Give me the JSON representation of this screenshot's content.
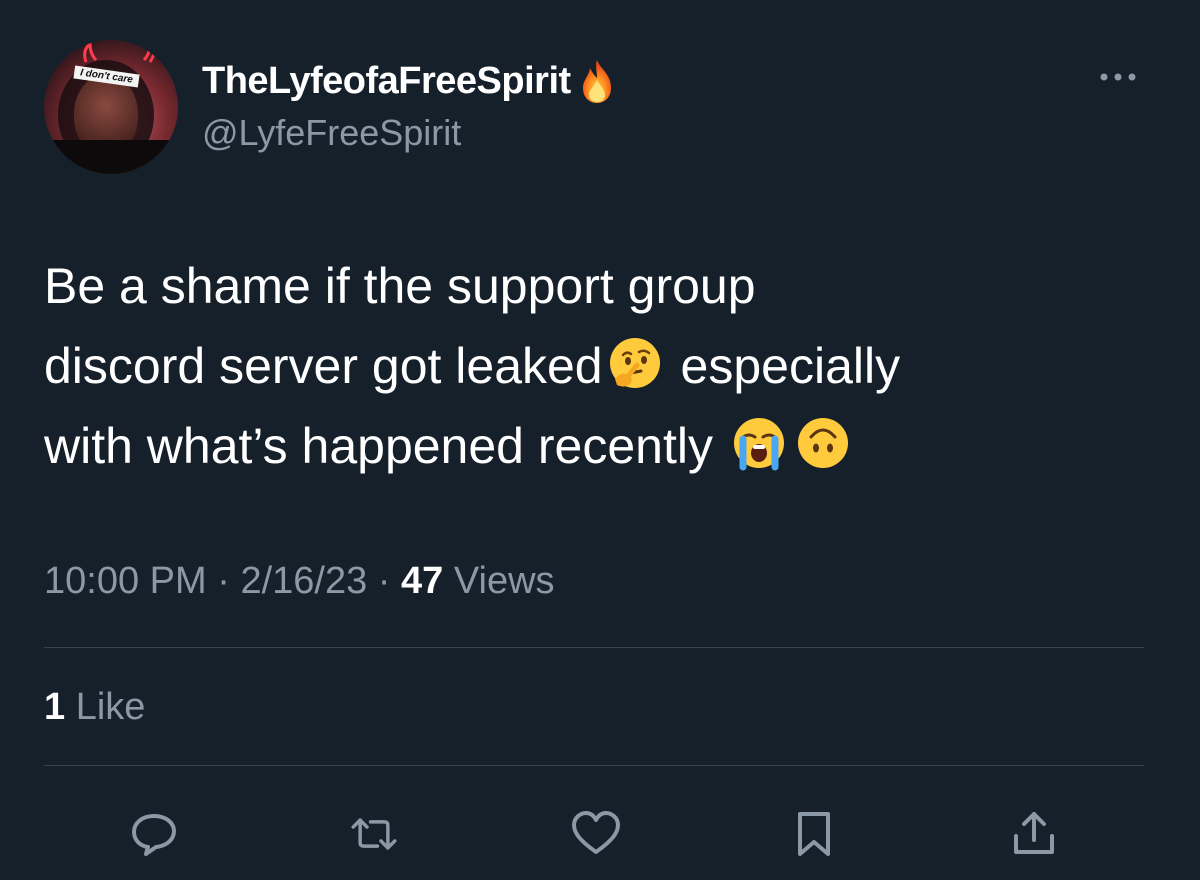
{
  "author": {
    "display_name": "TheLyfeofaFreeSpirit",
    "handle": "@LyfeFreeSpirit",
    "avatar_sticker_text": "I don't care",
    "badge_icon": "fire-icon"
  },
  "tweet": {
    "text_lines": [
      "Be a shame if the support group",
      "discord server got leaked",
      "especially",
      "with what’s happened recently"
    ],
    "emojis": [
      "thinking-face",
      "loudly-crying-face",
      "upside-down-face"
    ]
  },
  "meta": {
    "time": "10:00 PM",
    "separator": "·",
    "date": "2/16/23",
    "views_count": "47",
    "views_label": "Views"
  },
  "engagement": {
    "likes_count": "1",
    "likes_label": "Like"
  },
  "actions": [
    {
      "name": "reply",
      "icon": "reply-icon"
    },
    {
      "name": "retweet",
      "icon": "retweet-icon"
    },
    {
      "name": "like",
      "icon": "heart-icon"
    },
    {
      "name": "bookmark",
      "icon": "bookmark-icon"
    },
    {
      "name": "share",
      "icon": "share-icon"
    }
  ],
  "colors": {
    "background": "#15202b",
    "primary_text": "#ffffff",
    "secondary_text": "#8b98a5",
    "divider": "#38444d"
  }
}
